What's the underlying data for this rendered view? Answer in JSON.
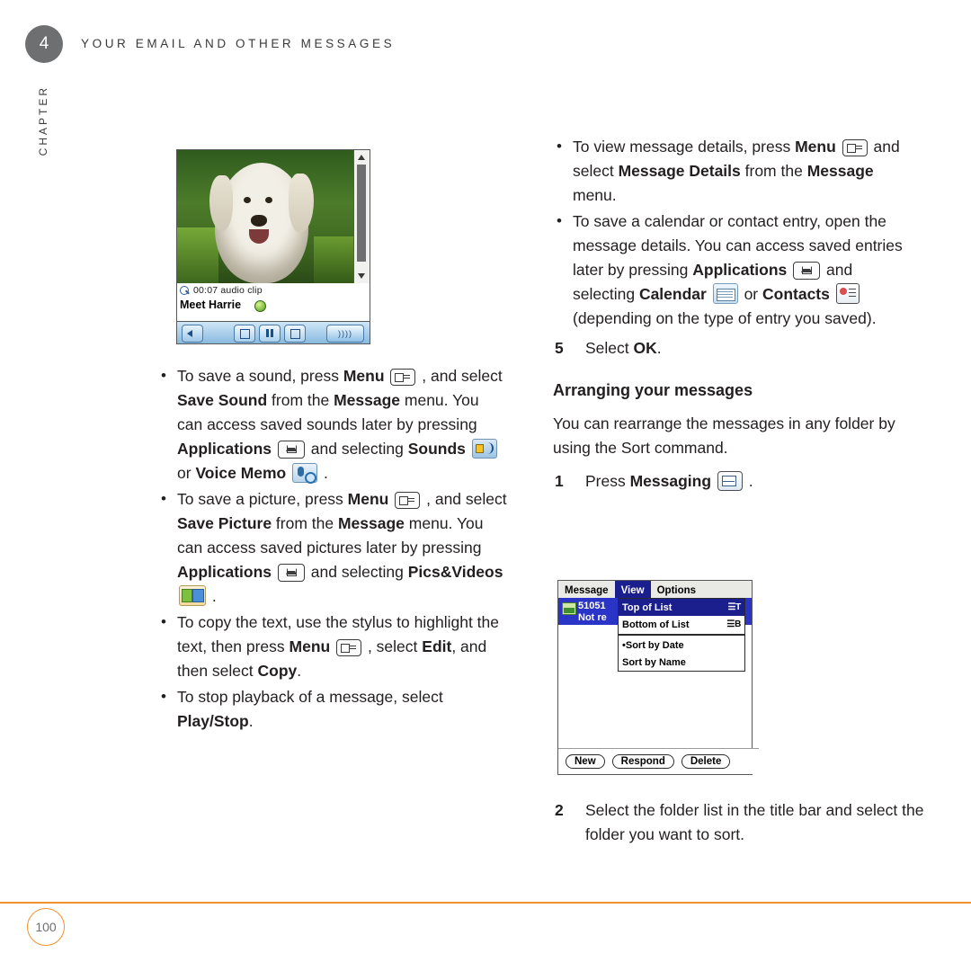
{
  "header": {
    "chapter_number": "4",
    "title": "YOUR EMAIL AND OTHER MESSAGES",
    "chapter_label": "CHAPTER"
  },
  "footer": {
    "page_number": "100"
  },
  "media_player": {
    "clip_time": "00:07 audio clip",
    "clip_title": "Meet Harrie",
    "volume_label": "))))"
  },
  "left_column": {
    "bullets": [
      {
        "id": "save-sound",
        "parts": [
          {
            "t": "To save a sound, press ",
            "b": false
          },
          {
            "t": "Menu",
            "b": true
          },
          {
            "t": " ",
            "b": false
          },
          {
            "icon": "menu-icon"
          },
          {
            "t": " , and select ",
            "b": false
          },
          {
            "t": "Save Sound",
            "b": true
          },
          {
            "t": " from the ",
            "b": false
          },
          {
            "t": "Message",
            "b": true
          },
          {
            "t": " menu. You can access saved sounds later by pressing ",
            "b": false
          },
          {
            "t": "Applications",
            "b": true
          },
          {
            "t": " ",
            "b": false
          },
          {
            "icon": "home-icon"
          },
          {
            "t": " and selecting ",
            "b": false
          },
          {
            "t": "Sounds",
            "b": true
          },
          {
            "t": " ",
            "b": false
          },
          {
            "icon": "sounds-icon"
          },
          {
            "t": " or ",
            "b": false
          },
          {
            "t": "Voice Memo",
            "b": true
          },
          {
            "t": " ",
            "b": false
          },
          {
            "icon": "voice-memo-icon"
          },
          {
            "t": " .",
            "b": false
          }
        ]
      },
      {
        "id": "save-picture",
        "parts": [
          {
            "t": "To save a picture, press ",
            "b": false
          },
          {
            "t": "Menu",
            "b": true
          },
          {
            "t": " ",
            "b": false
          },
          {
            "icon": "menu-icon"
          },
          {
            "t": " , and select ",
            "b": false
          },
          {
            "t": "Save Picture",
            "b": true
          },
          {
            "t": " from the ",
            "b": false
          },
          {
            "t": "Message",
            "b": true
          },
          {
            "t": " menu. You can access saved pictures later by pressing ",
            "b": false
          },
          {
            "t": "Applications",
            "b": true
          },
          {
            "t": " ",
            "b": false
          },
          {
            "icon": "home-icon"
          },
          {
            "t": " and selecting ",
            "b": false
          },
          {
            "t": "Pics&Videos",
            "b": true
          },
          {
            "t": " ",
            "b": false
          },
          {
            "icon": "pics-videos-icon"
          },
          {
            "t": " .",
            "b": false
          }
        ]
      },
      {
        "id": "copy-text",
        "parts": [
          {
            "t": "To copy the text, use the stylus to highlight the text, then press ",
            "b": false
          },
          {
            "t": "Menu",
            "b": true
          },
          {
            "t": " ",
            "b": false
          },
          {
            "icon": "menu-icon"
          },
          {
            "t": " , select ",
            "b": false
          },
          {
            "t": "Edit",
            "b": true
          },
          {
            "t": ", and then select ",
            "b": false
          },
          {
            "t": "Copy",
            "b": true
          },
          {
            "t": ".",
            "b": false
          }
        ]
      },
      {
        "id": "stop-playback",
        "parts": [
          {
            "t": "To stop playback of a message, select ",
            "b": false
          },
          {
            "t": "Play/Stop",
            "b": true
          },
          {
            "t": ".",
            "b": false
          }
        ]
      }
    ]
  },
  "right_column": {
    "bullets": [
      {
        "id": "view-message-details",
        "parts": [
          {
            "t": "To view message details, press ",
            "b": false
          },
          {
            "t": "Menu",
            "b": true
          },
          {
            "t": " ",
            "b": false
          },
          {
            "icon": "menu-icon"
          },
          {
            "t": " and select ",
            "b": false
          },
          {
            "t": "Message Details",
            "b": true
          },
          {
            "t": " from the ",
            "b": false
          },
          {
            "t": "Message",
            "b": true
          },
          {
            "t": " menu.",
            "b": false
          }
        ]
      },
      {
        "id": "save-calendar-contact",
        "parts": [
          {
            "t": "To save a calendar or contact entry, open the message details. You can access saved entries later by pressing ",
            "b": false
          },
          {
            "t": "Applications",
            "b": true
          },
          {
            "t": " ",
            "b": false
          },
          {
            "icon": "home-icon"
          },
          {
            "t": " and selecting ",
            "b": false
          },
          {
            "t": "Calendar",
            "b": true
          },
          {
            "t": " ",
            "b": false
          },
          {
            "icon": "calendar-icon"
          },
          {
            "t": " or ",
            "b": false
          },
          {
            "t": "Contacts",
            "b": true
          },
          {
            "t": " ",
            "b": false
          },
          {
            "icon": "contacts-icon"
          },
          {
            "t": " (depending on the type of entry you saved).",
            "b": false
          }
        ]
      }
    ],
    "step_5": {
      "number": "5",
      "parts": [
        {
          "t": "Select ",
          "b": false
        },
        {
          "t": "OK",
          "b": true
        },
        {
          "t": ".",
          "b": false
        }
      ]
    },
    "section_heading": "Arranging your messages",
    "paragraph": "You can rearrange the messages in any folder by using the Sort command.",
    "step_1": {
      "number": "1",
      "parts": [
        {
          "t": "Press ",
          "b": false
        },
        {
          "t": "Messaging",
          "b": true
        },
        {
          "t": " ",
          "b": false
        },
        {
          "icon": "messaging-icon"
        },
        {
          "t": " .",
          "b": false
        }
      ]
    },
    "step_2": {
      "number": "2",
      "text": "Select the folder list in the title bar and select the folder you want to sort."
    }
  },
  "treo_screenshot": {
    "menubar": [
      "Message",
      "View",
      "Options"
    ],
    "menubar_selected": "View",
    "dropdown_items": [
      {
        "label": "Top of List",
        "shortcut": "☰T",
        "highlighted": true
      },
      {
        "label": "Bottom of List",
        "shortcut": "☰B",
        "highlighted": false
      },
      {
        "label": "•Sort by Date",
        "shortcut": "",
        "highlighted": false
      },
      {
        "label": " Sort by Name",
        "shortcut": "",
        "highlighted": false
      }
    ],
    "list_row": {
      "line1": "51051",
      "line2": "Not re"
    },
    "buttons": [
      "New",
      "Respond",
      "Delete"
    ]
  }
}
